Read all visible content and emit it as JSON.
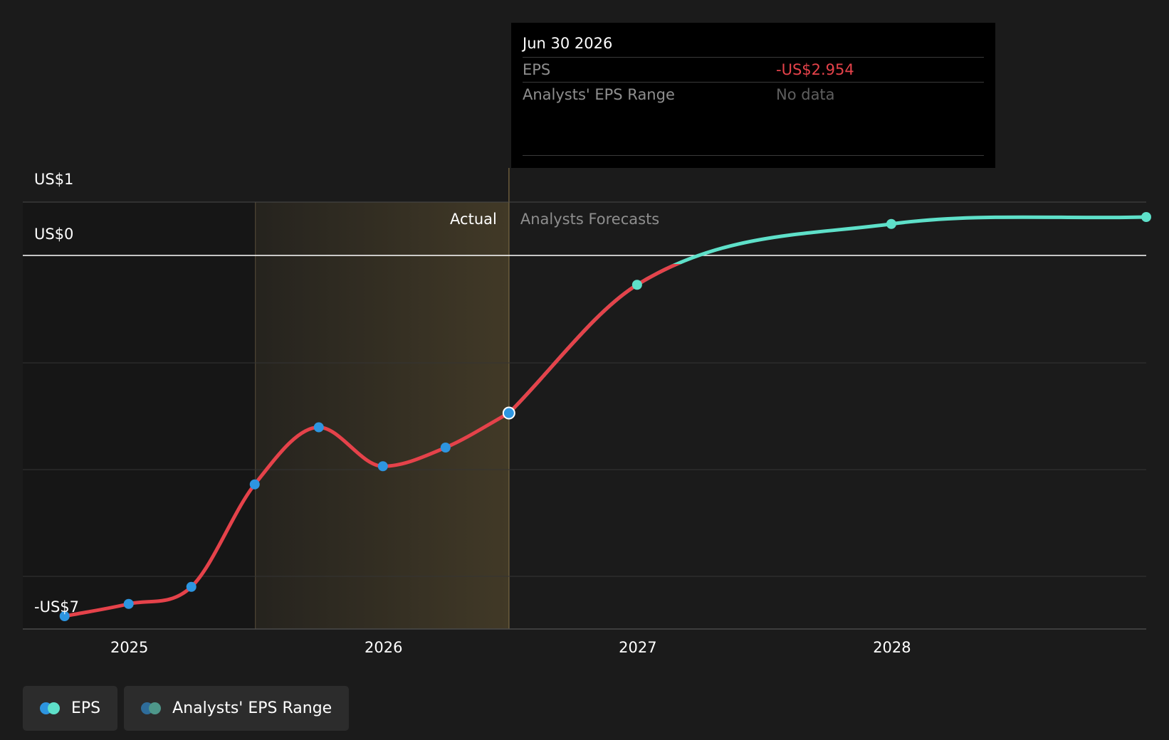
{
  "chart_data": {
    "type": "line",
    "y_axis_labels": [
      "US$1",
      "US$0",
      "-US$7"
    ],
    "x_ticks": [
      2025,
      2026,
      2027,
      2028
    ],
    "x_range": [
      "2024-08-01",
      "2028-12-31"
    ],
    "y_range": [
      -7,
      1
    ],
    "past_region_start": "2025-07-01",
    "divider_date": "2026-06-30",
    "region_labels": {
      "actual": "Actual",
      "forecast": "Analysts Forecasts"
    },
    "series": [
      {
        "name": "EPS",
        "segment": "actual",
        "color": "#e5424a",
        "points": [
          {
            "date": "2024-09-30",
            "value": -6.76
          },
          {
            "date": "2024-12-31",
            "value": -6.53
          },
          {
            "date": "2025-03-31",
            "value": -6.21
          },
          {
            "date": "2025-06-30",
            "value": -4.29
          },
          {
            "date": "2025-09-30",
            "value": -3.22
          },
          {
            "date": "2025-12-31",
            "value": -3.95
          },
          {
            "date": "2026-03-31",
            "value": -3.6
          },
          {
            "date": "2026-06-30",
            "value": -2.954
          }
        ]
      },
      {
        "name": "EPS",
        "segment": "forecast",
        "color": "#5ee0c9",
        "points": [
          {
            "date": "2026-06-30",
            "value": -2.954
          },
          {
            "date": "2026-12-31",
            "value": -0.55
          },
          {
            "date": "2027-12-31",
            "value": 0.59
          },
          {
            "date": "2028-12-31",
            "value": 0.72
          }
        ]
      }
    ],
    "colors": {
      "eps_actual": "#e5424a",
      "eps_forecast": "#5ee0c9",
      "actual_marker": "#2d95e0",
      "range_dot_dark": "#2e6c9a",
      "range_dot_light": "#4e978a",
      "highlight": "#c9a450"
    }
  },
  "tooltip": {
    "date": "Jun 30 2026",
    "eps_label": "EPS",
    "eps_value": "-US$2.954",
    "range_label": "Analysts' EPS Range",
    "range_value": "No data"
  },
  "legend": {
    "eps": "EPS",
    "range": "Analysts' EPS Range"
  }
}
